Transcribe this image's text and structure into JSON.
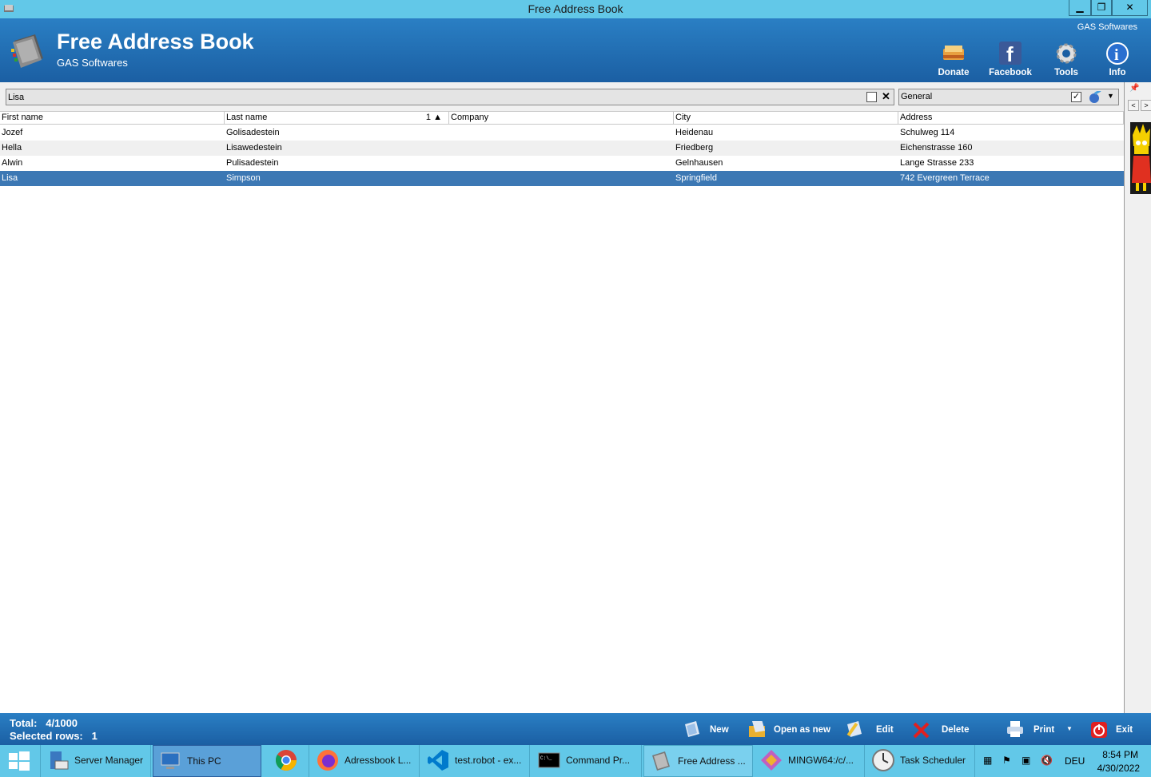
{
  "window": {
    "title": "Free Address Book"
  },
  "header": {
    "app_title": "Free Address Book",
    "subtitle": "GAS Softwares",
    "corner_label": "GAS Softwares"
  },
  "toolbar": {
    "donate": "Donate",
    "facebook": "Facebook",
    "tools": "Tools",
    "info": "Info"
  },
  "search": {
    "value": "Lisa",
    "checked": false
  },
  "group": {
    "value": "General",
    "checked": true
  },
  "grid": {
    "columns": [
      "First name",
      "Last name",
      "Company",
      "City",
      "Address"
    ],
    "sort_index": "1",
    "rows": [
      [
        "Jozef",
        "Golisadestein",
        "",
        "Heidenau",
        "Schulweg 114"
      ],
      [
        "Hella",
        "Lisawedestein",
        "",
        "Friedberg",
        "Eichenstrasse 160"
      ],
      [
        "Alwin",
        "Pulisadestein",
        "",
        "Gelnhausen",
        "Lange Strasse 233"
      ],
      [
        "Lisa",
        "Simpson",
        "",
        "Springfield",
        "742 Evergreen Terrace"
      ]
    ],
    "selected_row": 3
  },
  "status": {
    "total_label": "Total:",
    "total_value": "4/1000",
    "selected_label": "Selected rows:",
    "selected_value": "1"
  },
  "actions": {
    "new": "New",
    "open_as_new": "Open as new",
    "edit": "Edit",
    "delete": "Delete",
    "print": "Print",
    "exit": "Exit"
  },
  "taskbar": {
    "items": [
      {
        "label": "Server Manager",
        "icon": "server-manager-icon"
      },
      {
        "label": "This PC",
        "icon": "this-pc-icon"
      },
      {
        "label": "",
        "icon": "chrome-icon"
      },
      {
        "label": "Adressbook L...",
        "icon": "firefox-icon"
      },
      {
        "label": "test.robot - ex...",
        "icon": "vscode-icon"
      },
      {
        "label": "Command Pr...",
        "icon": "cmd-icon"
      },
      {
        "label": "Free Address ...",
        "icon": "address-book-icon"
      },
      {
        "label": "MINGW64:/c/...",
        "icon": "git-icon"
      },
      {
        "label": "Task Scheduler",
        "icon": "clock-icon"
      }
    ],
    "language": "DEU",
    "time": "8:54 PM",
    "date": "4/30/2022"
  }
}
